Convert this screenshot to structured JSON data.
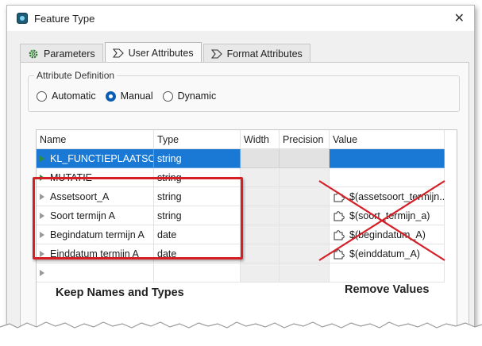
{
  "window": {
    "title": "Feature Type",
    "close_glyph": "✕"
  },
  "tabs": [
    {
      "label": "Parameters",
      "icon": "gear-icon"
    },
    {
      "label": "User Attributes",
      "icon": "attribute-icon"
    },
    {
      "label": "Format Attributes",
      "icon": "attribute-icon"
    }
  ],
  "active_tab": "User Attributes",
  "attribute_definition": {
    "legend": "Attribute Definition",
    "options": [
      "Automatic",
      "Manual",
      "Dynamic"
    ],
    "selected": "Manual"
  },
  "table": {
    "headers": [
      "Name",
      "Type",
      "Width",
      "Precision",
      "Value"
    ],
    "rows": [
      {
        "name": "KL_FUNCTIEPLAATSC...",
        "type": "string",
        "width": "",
        "precision": "",
        "value": "",
        "selected": true
      },
      {
        "name": "MUTATIE",
        "type": "string",
        "width": "",
        "precision": "",
        "value": ""
      },
      {
        "name": "Assetsoort_A",
        "type": "string",
        "width": "",
        "precision": "",
        "value": "$(assetsoort_termijn..."
      },
      {
        "name": "Soort termijn A",
        "type": "string",
        "width": "",
        "precision": "",
        "value": "$(soort_termijn_a)"
      },
      {
        "name": "Begindatum termijn A",
        "type": "date",
        "width": "",
        "precision": "",
        "value": "$(begindatum_A)"
      },
      {
        "name": "Einddatum termijn A",
        "type": "date",
        "width": "",
        "precision": "",
        "value": "$(einddatum_A)"
      }
    ]
  },
  "annotations": {
    "keep": "Keep Names and Types",
    "remove": "Remove Values",
    "highlight_color": "#d41f26"
  },
  "colors": {
    "selection": "#1979d4",
    "accent": "#0a5fb4"
  }
}
